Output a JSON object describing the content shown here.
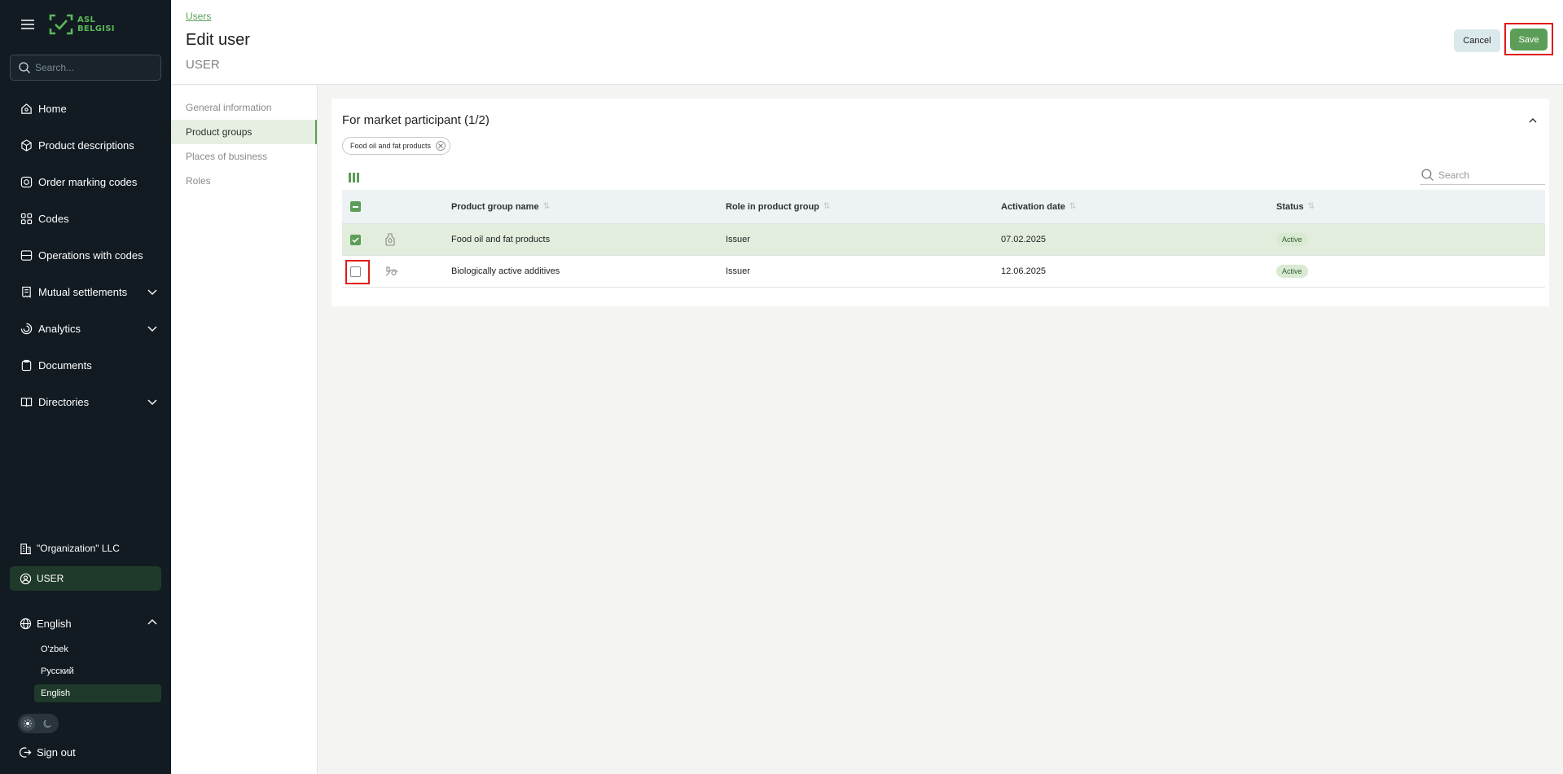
{
  "app": {
    "logo_line1": "ASL",
    "logo_line2": "BELGISI"
  },
  "sidebar": {
    "search_placeholder": "Search...",
    "items": [
      {
        "label": "Home",
        "icon": "home-icon"
      },
      {
        "label": "Product descriptions",
        "icon": "box-icon"
      },
      {
        "label": "Order marking codes",
        "icon": "order-codes-icon"
      },
      {
        "label": "Codes",
        "icon": "codes-icon"
      },
      {
        "label": "Operations with codes",
        "icon": "operations-icon"
      },
      {
        "label": "Mutual settlements",
        "icon": "receipt-icon"
      },
      {
        "label": "Analytics",
        "icon": "analytics-icon"
      },
      {
        "label": "Documents",
        "icon": "document-icon"
      },
      {
        "label": "Directories",
        "icon": "book-icon"
      }
    ],
    "organization": "\"Organization\" LLC",
    "user": "USER",
    "language": {
      "current": "English",
      "options": [
        "O'zbek",
        "Русский",
        "English"
      ]
    },
    "sign_out": "Sign out"
  },
  "header": {
    "breadcrumb": "Users",
    "title": "Edit user",
    "subtitle": "USER",
    "cancel_label": "Cancel",
    "save_label": "Save"
  },
  "subnav": {
    "items": [
      "General information",
      "Product groups",
      "Places of business",
      "Roles"
    ],
    "active": "Product groups"
  },
  "panel": {
    "title": "For market participant (1/2)",
    "chip": "Food oil and fat products",
    "search_placeholder": "Search",
    "table": {
      "headers": {
        "name": "Product group name",
        "role": "Role in product group",
        "date": "Activation date",
        "status": "Status"
      },
      "rows": [
        {
          "checked": true,
          "icon": "oil-bottle-icon",
          "name": "Food oil and fat products",
          "role": "Issuer",
          "date": "07.02.2025",
          "status": "Active"
        },
        {
          "checked": false,
          "icon": "supplement-icon",
          "name": "Biologically active additives",
          "role": "Issuer",
          "date": "12.06.2025",
          "status": "Active"
        }
      ]
    }
  },
  "colors": {
    "sidebar_bg": "#121b22",
    "accent_green": "#5c9e57",
    "highlight_red": "#e01b1b"
  }
}
